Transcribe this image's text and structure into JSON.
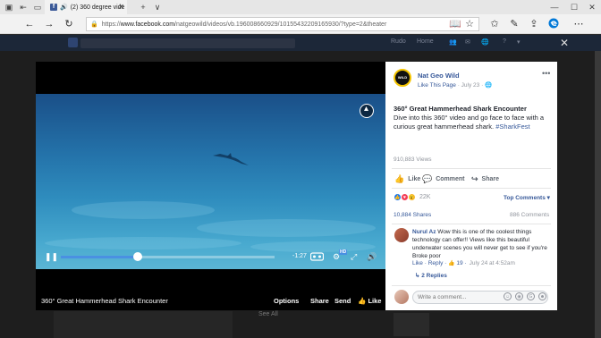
{
  "browser": {
    "tab_title": "(2) 360 degree vide",
    "fb_favicon": "f",
    "speaker_icon": "speaker-icon",
    "tab_close": "✕",
    "new_tab": "+",
    "tab_list": "∨",
    "url_scheme": "https://",
    "url_host": "www.facebook.com",
    "url_path": "/natgeowild/videos/vb.196008660929/10155432209165930/?type=2&theater",
    "accent": "#0078d7"
  },
  "fb_header": {
    "item1": "Rudo",
    "item2": "Home"
  },
  "video": {
    "time_remaining": "-1:27",
    "hd_badge": "HD",
    "title": "360° Great Hammerhead Shark Encounter",
    "options_label": "Options",
    "share_label": "Share",
    "send_label": "Send",
    "like_label": "Like",
    "progress": 0.36
  },
  "post": {
    "page_name": "Nat Geo Wild",
    "avatar_text": "WILD",
    "like_page": "Like This Page",
    "date": "July 23",
    "title": "360° Great Hammerhead Shark Encounter",
    "desc": "Dive into this 360° video and go face to face with a curious great hammerhead shark.",
    "hashtag": "#SharkFest",
    "views": "910,883 Views",
    "like": "Like",
    "comment": "Comment",
    "share": "Share",
    "reaction_count": "22K",
    "top_comments": "Top Comments",
    "shares": "10,884 Shares",
    "comment_count": "886 Comments",
    "reaction_colors": [
      "#1877f2",
      "#f33e58",
      "#f7b928"
    ]
  },
  "comment": {
    "author": "Nurul Az",
    "text": "Wow this is one of the coolest things technology can offer!! Views like this beautiful underwater scenes you will never get to see if you're Broke poor",
    "like": "Like",
    "reply": "Reply",
    "likes": "19",
    "time": "July 24 at 4:52am",
    "replies": "2 Replies",
    "placeholder": "Write a comment..."
  },
  "background": {
    "see_all": "See All"
  }
}
